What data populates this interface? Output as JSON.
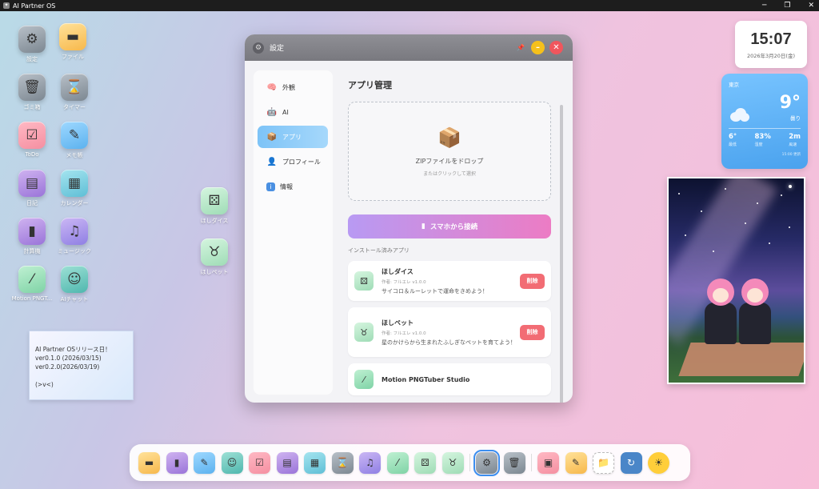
{
  "titlebar": {
    "title": "AI Partner OS"
  },
  "desktop_icons": [
    {
      "label": "設定"
    },
    {
      "label": "ファイル"
    },
    {
      "label": "ゴミ箱"
    },
    {
      "label": "タイマー"
    },
    {
      "label": "ToDo"
    },
    {
      "label": "メモ帳"
    },
    {
      "label": "日記"
    },
    {
      "label": "カレンダー"
    },
    {
      "label": "計算機"
    },
    {
      "label": "ミュージック"
    },
    {
      "label": "Motion PNGT..."
    },
    {
      "label": "AIチャット"
    },
    {
      "label": "ほしダイス"
    },
    {
      "label": "ほしペット"
    }
  ],
  "note": {
    "lines": [
      "AI Partner OSリリース日！",
      "ver0.1.0 (2026/03/15)",
      "ver0.2.0(2026/03/19)",
      "",
      "(>v<)"
    ]
  },
  "clock": {
    "time": "15:07",
    "date": "2026年3月20日(金)"
  },
  "weather": {
    "city": "東京",
    "temp": "9°",
    "condition": "曇り",
    "stats": [
      {
        "value": "6°",
        "label": "最低"
      },
      {
        "value": "83%",
        "label": "湿度"
      },
      {
        "value": "2m",
        "label": "風速"
      }
    ],
    "updated": "15:00 更新"
  },
  "settings": {
    "title": "設定",
    "nav": [
      {
        "label": "外観",
        "icon": "brain-icon"
      },
      {
        "label": "AI",
        "icon": "robot-icon"
      },
      {
        "label": "アプリ",
        "icon": "package-icon"
      },
      {
        "label": "プロフィール",
        "icon": "user-icon"
      },
      {
        "label": "情報",
        "icon": "info-icon"
      }
    ],
    "heading": "アプリ管理",
    "drop_title": "ZIPファイルをドロップ",
    "drop_sub": "またはクリックして選択",
    "connect_label": "スマホから接続",
    "installed_label": "インストール済みアプリ",
    "apps": [
      {
        "name": "ほしダイス",
        "author": "作者: フルエレ v1.0.0",
        "desc": "サイコロ＆ルーレットで運命をきめよう！",
        "delete": "削除"
      },
      {
        "name": "ほしペット",
        "author": "作者: フルエレ v1.0.0",
        "desc": "星のかけらから生まれたふしぎなペットを育てよう！",
        "delete": "削除"
      },
      {
        "name": "Motion PNGTuber Studio"
      }
    ]
  },
  "dock": [
    "folder-icon",
    "calculator-icon",
    "memo-icon",
    "robot-icon",
    "check-icon",
    "diary-icon",
    "calendar-icon",
    "timer-icon",
    "music-icon",
    "wand-icon",
    "dice-icon",
    "pet-icon",
    "gear-icon",
    "trash-icon",
    "image-icon",
    "sticky-note-icon",
    "file-icon",
    "refresh-icon",
    "sun-icon"
  ],
  "colors": {
    "accent": "#7dc3f7",
    "gradient_start": "#b89af3",
    "gradient_end": "#ec7cc4",
    "danger": "#f26c74"
  }
}
